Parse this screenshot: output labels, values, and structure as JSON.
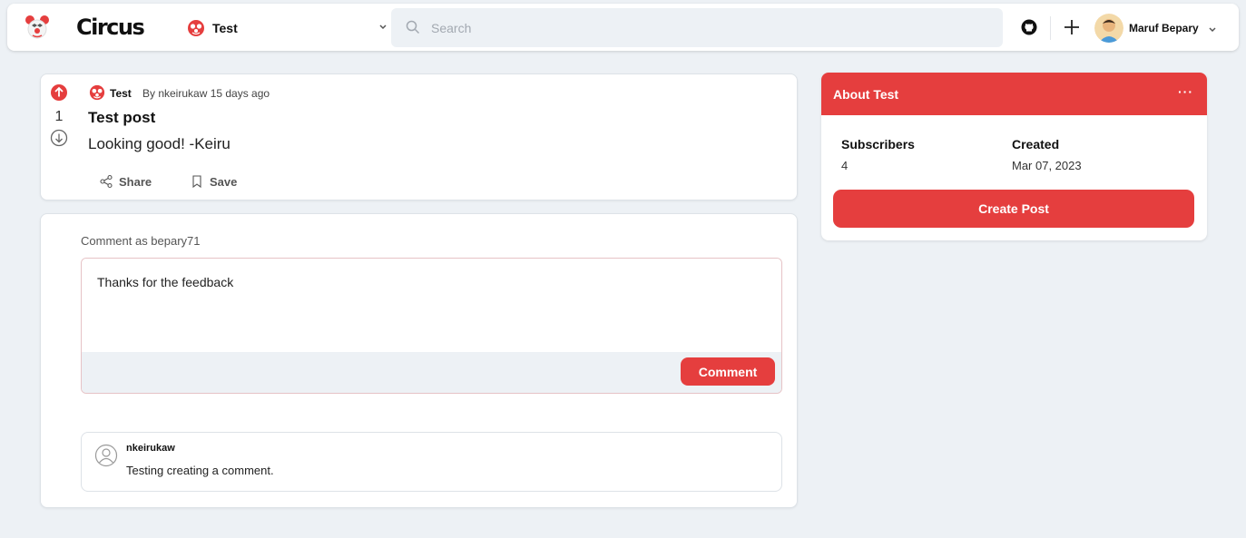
{
  "navbar": {
    "brand": "Circus",
    "community": "Test",
    "search_placeholder": "Search",
    "user_name": "Maruf Bepary"
  },
  "post": {
    "votes": "1",
    "community": "Test",
    "byline": "By nkeirukaw 15 days ago",
    "title": "Test post",
    "body": "Looking good! -Keiru",
    "share_label": "Share",
    "save_label": "Save"
  },
  "comment_form": {
    "comment_as": "Comment as bepary71",
    "value": "Thanks for the feedback",
    "submit_label": "Comment"
  },
  "comments": [
    {
      "author": "nkeirukaw",
      "text": "Testing creating a comment."
    }
  ],
  "about": {
    "title": "About Test",
    "more": "···",
    "subscribers_label": "Subscribers",
    "subscribers_value": "4",
    "created_label": "Created",
    "created_value": "Mar 07, 2023",
    "create_post_label": "Create Post"
  },
  "colors": {
    "accent": "#e53e3e",
    "background": "#edf1f5"
  }
}
